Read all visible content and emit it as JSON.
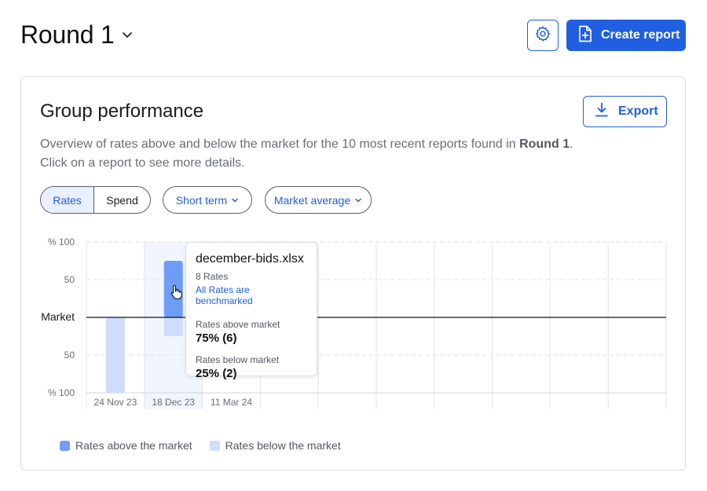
{
  "header": {
    "title": "Round 1",
    "create_report_label": "Create report"
  },
  "card": {
    "title": "Group performance",
    "export_label": "Export",
    "description_before": "Overview of rates above and below the market for the 10 most recent reports found in ",
    "description_bold": "Round 1",
    "description_after": ". Click on a report to see more details."
  },
  "filters": {
    "segment": [
      "Rates",
      "Spend"
    ],
    "segment_selected": "Rates",
    "term": "Short term",
    "market": "Market average"
  },
  "tooltip": {
    "file": "december-bids.xlsx",
    "rates_count": "8 Rates",
    "benchmark_link": "All Rates are benchmarked",
    "above_label": "Rates above market",
    "above_value": "75% (6)",
    "below_label": "Rates below market",
    "below_value": "25% (2)"
  },
  "legend": {
    "above": "Rates above the market",
    "below": "Rates below the market"
  },
  "colors": {
    "accent": "#1f5fe0",
    "bar_above": "#6f9cf5",
    "bar_below": "#cfdcfb",
    "highlight_column": "#f1f5ff"
  },
  "chart_data": {
    "type": "bar",
    "categories": [
      "24 Nov 23",
      "18 Dec 23",
      "11 Mar 24"
    ],
    "series": [
      {
        "name": "Rates above the market",
        "values": [
          0,
          75,
          null
        ]
      },
      {
        "name": "Rates below the market",
        "values": [
          100,
          25,
          null
        ]
      }
    ],
    "y_tick_labels_top": [
      "% 100",
      "50"
    ],
    "y_tick_labels_bottom": [
      "50",
      "% 100"
    ],
    "market_line_label": "Market",
    "ylim": [
      -100,
      100
    ],
    "total_slots": 10,
    "highlighted_category": "18 Dec 23",
    "grid": true
  }
}
